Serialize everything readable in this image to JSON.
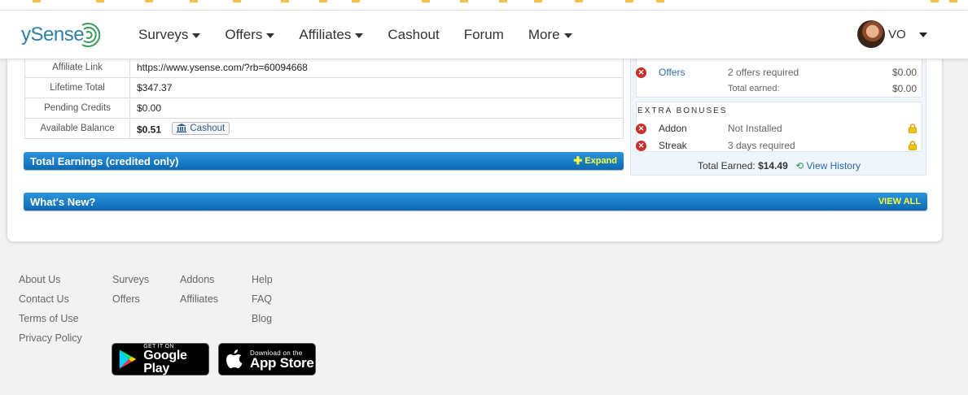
{
  "app": {
    "brand": "ySense"
  },
  "nav": {
    "items": [
      "Surveys",
      "Offers",
      "Affiliates",
      "Cashout",
      "Forum",
      "More"
    ],
    "user_name": "VO"
  },
  "stats": {
    "rows": [
      {
        "label": "Affiliate Link",
        "value": "https://www.ysense.com/?rb=60094668"
      },
      {
        "label": "Lifetime Total",
        "value": "$347.37"
      },
      {
        "label": "Pending Credits",
        "value": "$0.00"
      },
      {
        "label": "Available Balance",
        "value": "$0.51"
      }
    ],
    "cashout_button": "Cashout"
  },
  "total_earnings_bar": {
    "title": "Total Earnings (credited only)",
    "action": "Expand"
  },
  "whats_new_bar": {
    "title": "What's New?",
    "action": "VIEW ALL"
  },
  "bonuses": {
    "offers_row": {
      "name": "Offers",
      "desc": "2 offers required",
      "amount": "$0.00"
    },
    "total_row": {
      "desc": "Total earned:",
      "amount": "$0.00"
    },
    "extra_title": "EXTRA BONUSES",
    "extra": [
      {
        "name": "Addon",
        "desc": "Not Installed"
      },
      {
        "name": "Streak",
        "desc": "3 days required"
      }
    ],
    "total_earned_label": "Total Earned:",
    "total_earned_value": "$14.49",
    "view_history": "View History"
  },
  "footer": {
    "col1": [
      "About Us",
      "Contact Us",
      "Terms of Use",
      "Privacy Policy"
    ],
    "col2": [
      "Surveys",
      "Offers"
    ],
    "col3": [
      "Addons",
      "Affiliates"
    ],
    "col4": [
      "Help",
      "FAQ",
      "Blog"
    ],
    "google_play": {
      "small": "GET IT ON",
      "big": "Google Play"
    },
    "app_store": {
      "small": "Download on the",
      "big": "App Store"
    }
  },
  "colors": {
    "accent_bar": "#1583cf",
    "link": "#2b6aa8",
    "error_icon": "#c9302c",
    "lock": "#f1c40f",
    "expand_text": "#ffff3a"
  }
}
